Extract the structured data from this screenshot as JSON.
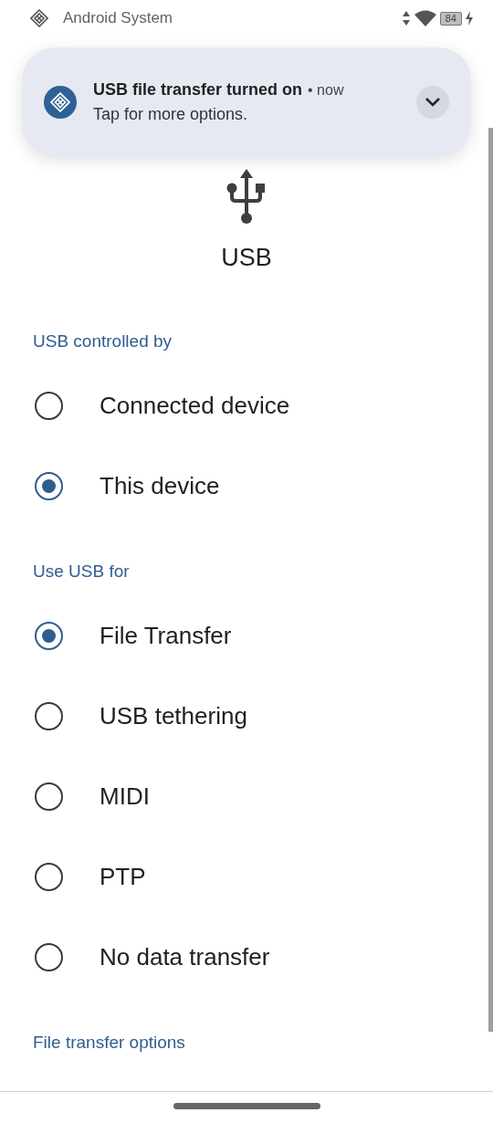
{
  "status_bar": {
    "app": "Android System",
    "battery": "84"
  },
  "notification": {
    "title": "USB file transfer turned on",
    "separator": "•",
    "time": "now",
    "text": "Tap for more options."
  },
  "title": "USB",
  "sections": [
    {
      "header": "USB controlled by",
      "options": [
        {
          "label": "Connected device",
          "selected": false
        },
        {
          "label": "This device",
          "selected": true
        }
      ]
    },
    {
      "header": "Use USB for",
      "options": [
        {
          "label": "File Transfer",
          "selected": true
        },
        {
          "label": "USB tethering",
          "selected": false
        },
        {
          "label": "MIDI",
          "selected": false
        },
        {
          "label": "PTP",
          "selected": false
        },
        {
          "label": "No data transfer",
          "selected": false
        }
      ]
    },
    {
      "header": "File transfer options"
    }
  ]
}
